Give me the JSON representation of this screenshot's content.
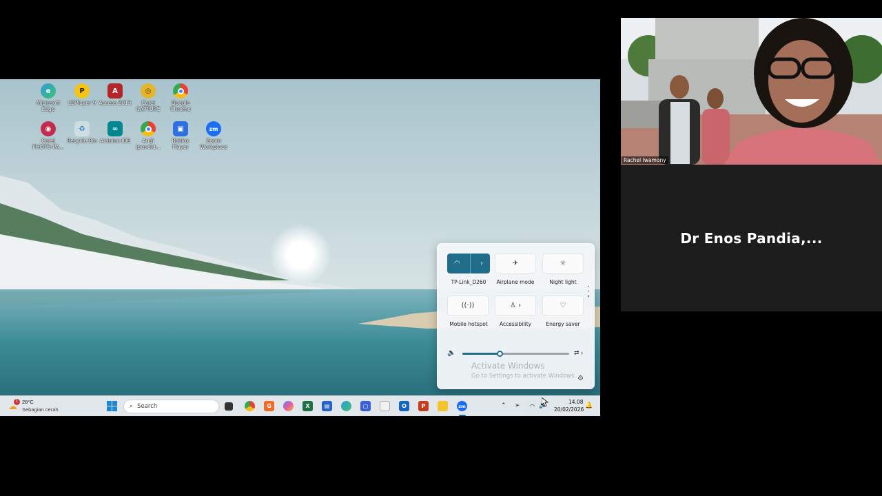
{
  "desktop": {
    "icons": [
      {
        "label": "Microsoft Edge",
        "icon": "edge-icon"
      },
      {
        "label": "LDPlayer 9",
        "icon": "ldplayer-icon"
      },
      {
        "label": "Access 2013",
        "icon": "access-icon"
      },
      {
        "label": "Corel CAPTURE",
        "icon": "corel-capture-icon"
      },
      {
        "label": "Google Chrome",
        "icon": "chrome-icon"
      },
      {
        "label": "Corel PHOTO-PA...",
        "icon": "corel-photopaint-icon"
      },
      {
        "label": "Recycle Bin",
        "icon": "recycle-bin-icon"
      },
      {
        "label": "Arduino IDE",
        "icon": "arduino-icon"
      },
      {
        "label": "Andi (pendid...",
        "icon": "chrome-profile-icon"
      },
      {
        "label": "Roblox Player",
        "icon": "roblox-icon"
      },
      {
        "label": "Zoom Workplace",
        "icon": "zoom-icon"
      }
    ]
  },
  "quick_settings": {
    "tiles": [
      {
        "label": "TP-Link_D260",
        "icon": "wifi-icon",
        "active": true
      },
      {
        "label": "Airplane mode",
        "icon": "airplane-icon",
        "active": false
      },
      {
        "label": "Night light",
        "icon": "night-light-icon",
        "active": false
      },
      {
        "label": "Mobile hotspot",
        "icon": "hotspot-icon",
        "active": false
      },
      {
        "label": "Accessibility",
        "icon": "accessibility-icon",
        "active": false
      },
      {
        "label": "Energy saver",
        "icon": "energy-saver-icon",
        "active": false
      }
    ],
    "volume_level": 0.35,
    "accent_color": "#1f6d8a"
  },
  "watermark": {
    "title": "Activate Windows",
    "subtitle": "Go to Settings to activate Windows."
  },
  "taskbar": {
    "weather_temp": "28°C",
    "weather_desc": "Sebagian cerah",
    "weather_badge": "1",
    "search_placeholder": "Search",
    "apps": [
      "start-icon",
      "task-view-icon",
      "chrome-icon",
      "sublime-icon",
      "copilot-icon",
      "excel-icon",
      "store-icon",
      "edge-icon",
      "app-icon",
      "notepad-icon",
      "outlook-icon",
      "powerpoint-icon",
      "file-explorer-icon",
      "zoom-icon"
    ],
    "time": "14.08",
    "date": "20/02/2026"
  },
  "participants": {
    "video_name": "Rachel Iwamony",
    "audio_only_name": "Dr Enos Pandia,..."
  }
}
